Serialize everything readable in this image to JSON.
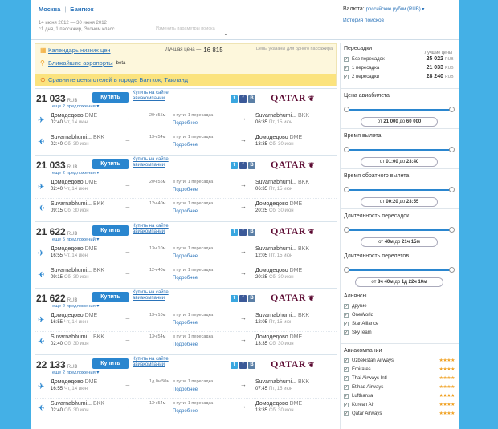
{
  "header": {
    "city_from": "Москва",
    "separator": "|",
    "city_to": "Бангкок",
    "dates": "14 июня 2012 — 30 июня 2012",
    "passengers": "с1 дня, 1 пассажир, Эконом класс",
    "hint": "Изменить параметры поиска",
    "currency_label": "Валюта:",
    "currency_value": "российские рубли (RUB) ▾",
    "history": "История поисков"
  },
  "info": {
    "calendar": "Календарь низких цен",
    "best_label": "Лучшая цена —",
    "best_value": "16 815",
    "price_note": "Цены указаны для одного пассажира",
    "airports": "Ближайшие аэропорты",
    "beta": "beta",
    "hotels": "Сравните цены отелей в городе Бангкок, Таиланд"
  },
  "card_labels": {
    "buy": "Купить",
    "buy_site_1": "Купить на сайте",
    "buy_site_2": "авиакомпании",
    "details": "Подробнее",
    "airline": "QATAR"
  },
  "cards": [
    {
      "price": "21 033",
      "currency": "RUB",
      "more": "еще 2 предложения ▾",
      "out": {
        "from": "Домодедово",
        "from_code": "DME",
        "dep": "02:40",
        "dep_day": "Чт, 14 июн",
        "dur": "20ч 55м",
        "stops": "в пути, 1 пересадка",
        "to": "Suvarnabhumi...",
        "to_code": "BKK",
        "arr": "06:35",
        "arr_day": "Пт, 15 июн"
      },
      "ret": {
        "from": "Suvarnabhumi...",
        "from_code": "BKK",
        "dep": "02:40",
        "dep_day": "Сб, 30 июн",
        "dur": "13ч 54м",
        "stops": "в пути, 1 пересадка",
        "to": "Домодедово",
        "to_code": "DME",
        "arr": "13:35",
        "arr_day": "Сб, 30 июн"
      }
    },
    {
      "price": "21 033",
      "currency": "RUB",
      "more": "еще 2 предложения ▾",
      "out": {
        "from": "Домодедово",
        "from_code": "DME",
        "dep": "02:40",
        "dep_day": "Чт, 14 июн",
        "dur": "20ч 55м",
        "stops": "в пути, 1 пересадка",
        "to": "Suvarnabhumi...",
        "to_code": "BKK",
        "arr": "06:35",
        "arr_day": "Пт, 15 июн"
      },
      "ret": {
        "from": "Suvarnabhumi...",
        "from_code": "BKK",
        "dep": "09:15",
        "dep_day": "Сб, 30 июн",
        "dur": "12ч 40м",
        "stops": "в пути, 1 пересадка",
        "to": "Домодедово",
        "to_code": "DME",
        "arr": "20:25",
        "arr_day": "Сб, 30 июн"
      }
    },
    {
      "price": "21 622",
      "currency": "RUB",
      "more": "еще 5 предложений ▾",
      "out": {
        "from": "Домодедово",
        "from_code": "DME",
        "dep": "16:55",
        "dep_day": "Чт, 14 июн",
        "dur": "13ч 10м",
        "stops": "в пути, 1 пересадка",
        "to": "Suvarnabhumi...",
        "to_code": "BKK",
        "arr": "12:05",
        "arr_day": "Пт, 15 июн"
      },
      "ret": {
        "from": "Suvarnabhumi...",
        "from_code": "BKK",
        "dep": "09:15",
        "dep_day": "Сб, 30 июн",
        "dur": "12ч 40м",
        "stops": "в пути, 1 пересадка",
        "to": "Домодедово",
        "to_code": "DME",
        "arr": "20:25",
        "arr_day": "Сб, 30 июн"
      }
    },
    {
      "price": "21 622",
      "currency": "RUB",
      "more": "еще 2 предложения ▾",
      "out": {
        "from": "Домодедово",
        "from_code": "DME",
        "dep": "16:55",
        "dep_day": "Чт, 14 июн",
        "dur": "13ч 10м",
        "stops": "в пути, 1 пересадка",
        "to": "Suvarnabhumi...",
        "to_code": "BKK",
        "arr": "12:05",
        "arr_day": "Пт, 15 июн"
      },
      "ret": {
        "from": "Suvarnabhumi...",
        "from_code": "BKK",
        "dep": "02:40",
        "dep_day": "Сб, 30 июн",
        "dur": "13ч 54м",
        "stops": "в пути, 1 пересадка",
        "to": "Домодедово",
        "to_code": "DME",
        "arr": "13:35",
        "arr_day": "Сб, 30 июн"
      }
    },
    {
      "price": "22 133",
      "currency": "RUB",
      "more": "еще 2 предложения ▾",
      "out": {
        "from": "Домодедово",
        "from_code": "DME",
        "dep": "16:55",
        "dep_day": "Чт, 14 июн",
        "dur": "1д 0ч 50м",
        "stops": "в пути, 1 пересадка",
        "to": "Suvarnabhumi...",
        "to_code": "BKK",
        "arr": "07:45",
        "arr_day": "Пт, 15 июн"
      },
      "ret": {
        "from": "Suvarnabhumi...",
        "from_code": "BKK",
        "dep": "02:40",
        "dep_day": "Сб, 30 июн",
        "dur": "13ч 54м",
        "stops": "в пути, 1 пересадка",
        "to": "Домодедово",
        "to_code": "DME",
        "arr": "13:35",
        "arr_day": "Сб, 30 июн"
      }
    }
  ],
  "sidebar": {
    "transfers": {
      "title": "Пересадки",
      "best_label": "Лучшие цены",
      "rows": [
        {
          "label": "Без пересадок",
          "value": "25 022",
          "cur": "RUB"
        },
        {
          "label": "1 пересадка",
          "value": "21 033",
          "cur": "RUB"
        },
        {
          "label": "2 пересадки",
          "value": "28 240",
          "cur": "RUB"
        }
      ]
    },
    "price": {
      "title": "Цена авиабилета",
      "from_label": "от",
      "from": "21 000",
      "to_label": "до",
      "to": "60 000"
    },
    "dep_time": {
      "title": "Время вылета",
      "from_label": "от",
      "from": "01:00",
      "to_label": "до",
      "to": "23:40"
    },
    "ret_time": {
      "title": "Время обратного вылета",
      "from_label": "от",
      "from": "00:20",
      "to_label": "до",
      "to": "23:55"
    },
    "layover": {
      "title": "Длительность пересадок",
      "from_label": "от",
      "from": "40м",
      "to_label": "до",
      "to": "21ч 15м"
    },
    "flight_dur": {
      "title": "Длительность перелетов",
      "from_label": "от",
      "from": "8ч 40м",
      "to_label": "до",
      "to": "1д 22ч 10м"
    },
    "alliances": {
      "title": "Альянсы",
      "items": [
        "другие",
        "OneWorld",
        "Star Alliance",
        "SkyTeam"
      ]
    },
    "airlines": {
      "title": "Авиакомпании",
      "items": [
        "Uzbekistan Airways",
        "Emirates",
        "Thai Airways Intl",
        "Etihad Airways",
        "Lufthansa",
        "Korean Air",
        "Qatar Airways"
      ],
      "stars": 4
    }
  }
}
